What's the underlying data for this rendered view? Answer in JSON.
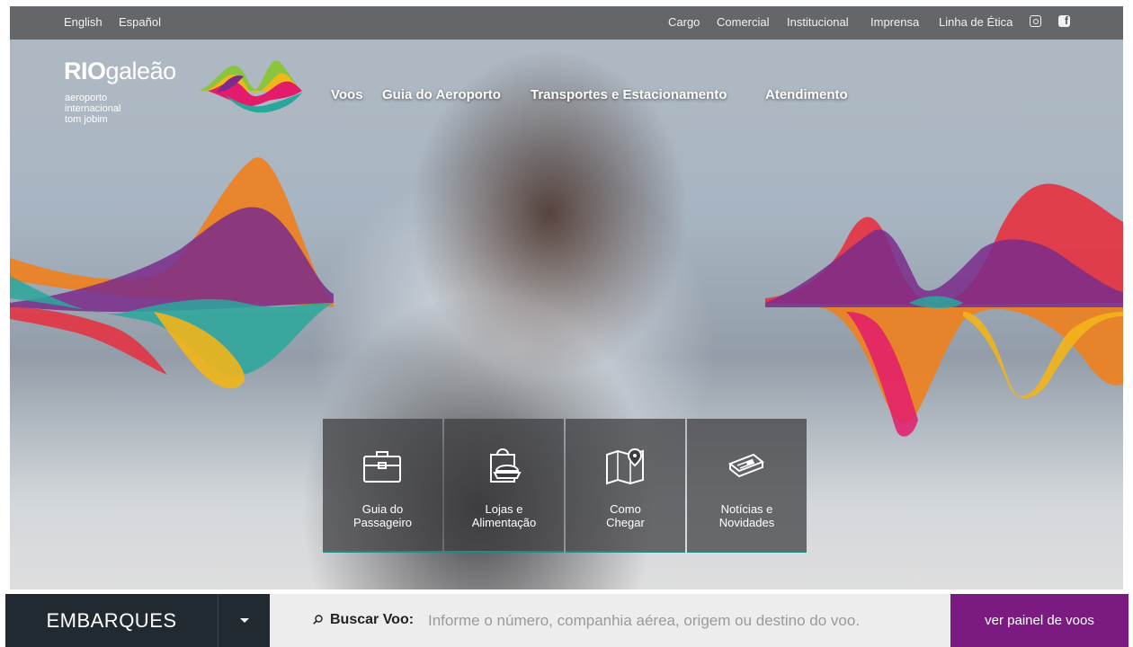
{
  "topbar": {
    "languages": [
      "English",
      "Español"
    ],
    "links": [
      "Cargo",
      "Comercial",
      "Institucional",
      "Imprensa",
      "Linha de Ética"
    ],
    "social_icons": [
      "instagram-icon",
      "facebook-icon"
    ]
  },
  "logo": {
    "brand_bold": "RIO",
    "brand_light": "galeão",
    "sub_lines": [
      "aeroporto",
      "internacional",
      "tom jobim"
    ]
  },
  "nav": {
    "items": [
      "Voos",
      "Guia do Aeroporto",
      "Transportes e Estacionamento",
      "Atendimento"
    ]
  },
  "tiles": [
    {
      "icon": "briefcase-icon",
      "line1": "Guia do",
      "line2": "Passageiro"
    },
    {
      "icon": "shopping-food-icon",
      "line1": "Lojas e",
      "line2": "Alimentação"
    },
    {
      "icon": "map-pin-icon",
      "line1": "Como",
      "line2": "Chegar"
    },
    {
      "icon": "newspaper-icon",
      "line1": "Notícias e",
      "line2": "Novidades"
    }
  ],
  "flight_bar": {
    "mode": "EMBARQUES",
    "search_label": "Buscar Voo:",
    "search_placeholder": "Informe o número, companhia aérea, origem ou destino do voo.",
    "panel_button": "ver painel de voos"
  },
  "colors": {
    "panel_button": "#7b1b82",
    "mode_bg": "#222a31",
    "tile_accent": "#1e8c82"
  }
}
